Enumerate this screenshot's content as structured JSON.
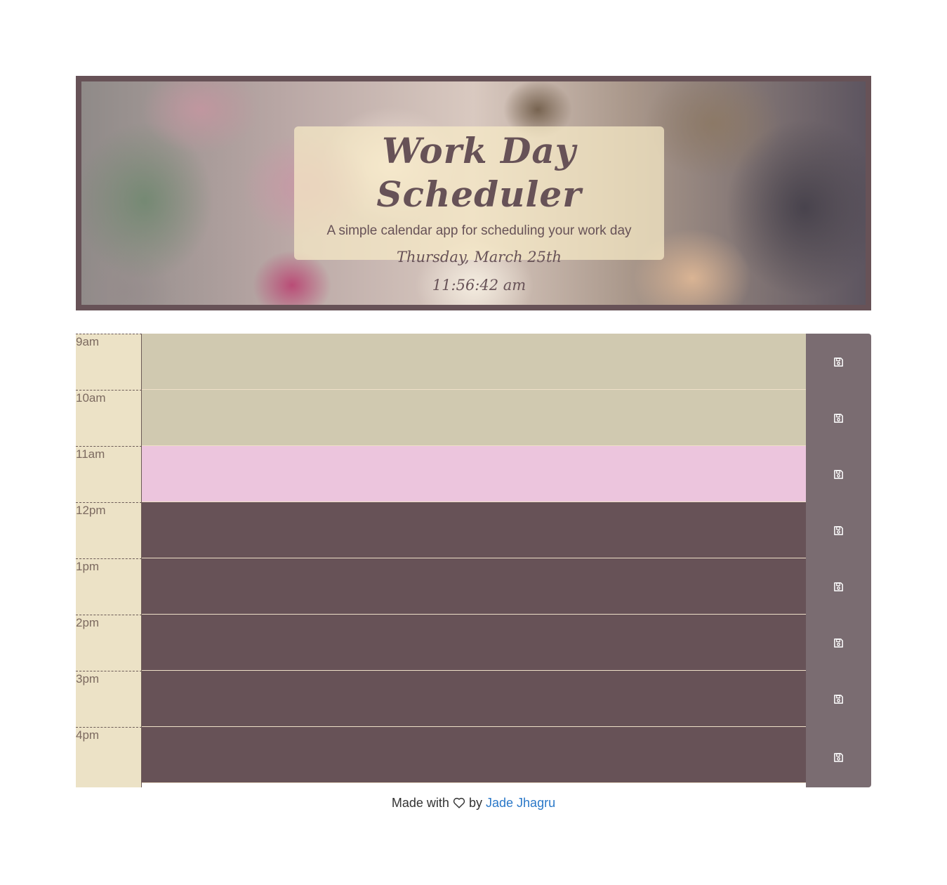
{
  "header": {
    "title": "Work Day Scheduler",
    "lead": "A simple calendar app for scheduling your work day",
    "current_date": "Thursday, March 25th",
    "current_time": "11:56:42 am"
  },
  "schedule": {
    "rows": [
      {
        "hour": "9am",
        "text": "",
        "state": "past"
      },
      {
        "hour": "10am",
        "text": "",
        "state": "past"
      },
      {
        "hour": "11am",
        "text": "",
        "state": "present"
      },
      {
        "hour": "12pm",
        "text": "",
        "state": "future"
      },
      {
        "hour": "1pm",
        "text": "",
        "state": "future"
      },
      {
        "hour": "2pm",
        "text": "",
        "state": "future"
      },
      {
        "hour": "3pm",
        "text": "",
        "state": "future"
      },
      {
        "hour": "4pm",
        "text": "",
        "state": "future"
      }
    ],
    "save_icon": "save-icon"
  },
  "colors": {
    "past": "#d0c9b0",
    "present": "#ecc5dd",
    "future": "#675257",
    "hour_column": "#ece2c6",
    "save_column": "#7a6c71",
    "frame": "#675257",
    "link": "#2a78c8"
  },
  "footer": {
    "made_with": "Made with",
    "by": "by",
    "author": "Jade Jhagru",
    "heart_icon": "heart-outline-icon"
  }
}
